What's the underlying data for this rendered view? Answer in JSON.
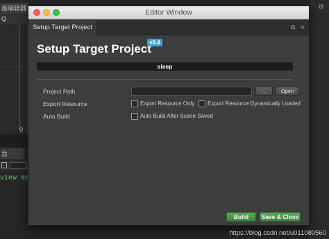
{
  "background": {
    "panel_title": "画编辑器",
    "toolbar_glyph": "Q",
    "graph_zero_label": "0",
    "console_tab_label": "台",
    "console_line": "view ser"
  },
  "window": {
    "title": "Editor Window",
    "tab_label": "Setup Target Project"
  },
  "project": {
    "heading": "Setup Target Project",
    "version_badge": "v0.4",
    "status": "sleep",
    "project_path_label": "Project Path",
    "project_path_value": "",
    "browse_button": "...",
    "open_button": "Open",
    "export_resource_label": "Export Resource",
    "export_only_label": "Export Resource Only",
    "export_only_checked": false,
    "export_dynamic_label": "Export Resource Dynamically Loaded",
    "export_dynamic_checked": false,
    "auto_build_label": "Auto Build",
    "auto_build_after_save_label": "Auto Build After Scene Saved",
    "auto_build_after_save_checked": false,
    "build_button": "Build",
    "save_close_button": "Save & Close"
  },
  "watermark": "https://blog.csdn.net/u011080560",
  "colors": {
    "primary_button": "#4e9a4e",
    "version_badge": "#3fa2d8",
    "panel_bg": "#3d3d3d",
    "console_text": "#62c88a"
  }
}
